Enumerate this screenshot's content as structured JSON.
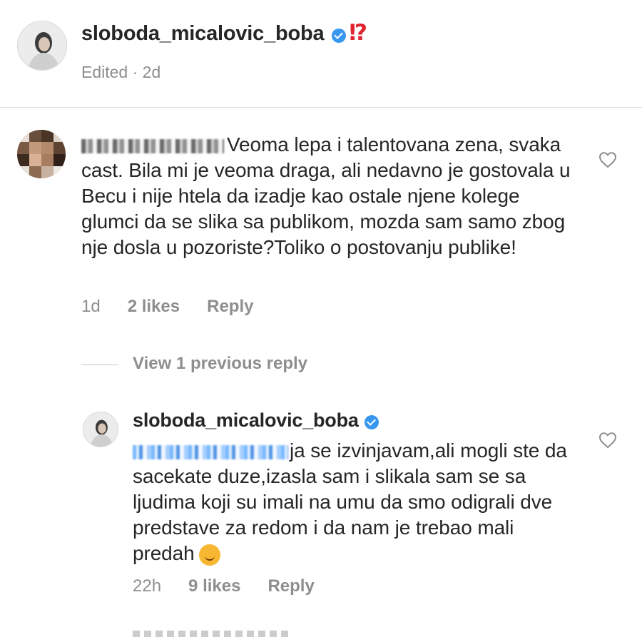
{
  "post": {
    "username": "sloboda_micalovic_boba",
    "badge_glyph": "⁉",
    "meta": "Edited · 2d"
  },
  "comment": {
    "text": "Veoma lepa i talentovana zena, svaka cast. Bila mi je veoma draga, ali nedavno je gostovala u Becu i nije htela da izadje kao ostale njene kolege glumci da se slika sa publikom, mozda sam samo zbog nje dosla u pozoriste?Toliko o postovanju publike!",
    "time": "1d",
    "likes": "2 likes",
    "reply": "Reply"
  },
  "view_previous": "View 1 previous reply",
  "reply": {
    "username": "sloboda_micalovic_boba",
    "text": "ja se izvinjavam,ali mogli ste da sacekate duze,izasla sam i slikala sam se sa ljudima koji su  imali  na umu da smo odigrali dve predstave za redom i da nam je trebao mali predah",
    "time": "22h",
    "likes": "9 likes",
    "reply": "Reply"
  },
  "colors": {
    "verified": "#3897f0",
    "exclaim": "#e0232e",
    "muted": "#8e8e8e"
  },
  "icons": [
    "verified-badge-icon",
    "heart-icon",
    "smiling-face-with-hearts-emoji"
  ]
}
